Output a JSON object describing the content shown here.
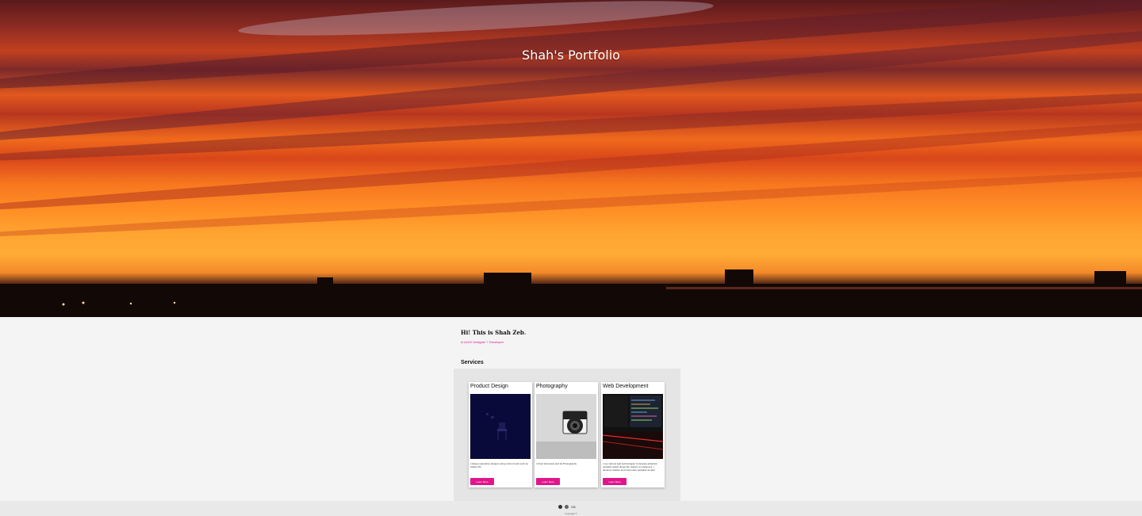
{
  "hero": {
    "title": "Shah's Portfolio"
  },
  "intro": {
    "title": "Hi! This is Shah Zeb.",
    "subtitle": "A UI/UX Designer + Developer"
  },
  "services": {
    "heading": "Services",
    "cards": [
      {
        "title": "Product Design",
        "description": "I design supportive designs using current tools such as Adobe XD.",
        "button": "Learn More",
        "image_icon": "chair-3d-render"
      },
      {
        "title": "Photography",
        "description": "I shoot interviews and do Photography.",
        "button": "Learn More",
        "image_icon": "camera-photo"
      },
      {
        "title": "Web Development",
        "description": "I use various web technologies to develop attractive websites which drives the visitors to customers. I develop creative and responsive websites as well.",
        "button": "Learn More",
        "image_icon": "code-monitor-keyboard"
      }
    ]
  },
  "footer": {
    "icons": [
      "facebook-icon",
      "github-icon"
    ],
    "extra": "GB",
    "copyright": "Copyright ©"
  },
  "colors": {
    "accent": "#e0168d",
    "page_bg": "#f4f4f4",
    "panel_bg": "#e5e5e5"
  }
}
